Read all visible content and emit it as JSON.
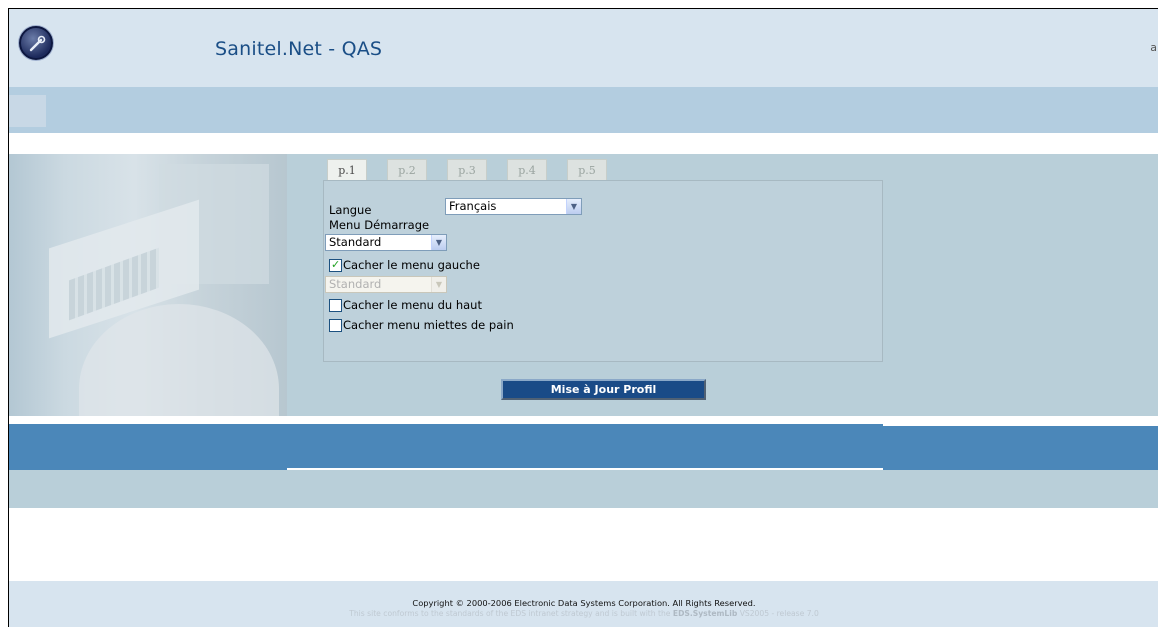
{
  "header": {
    "title": "Sanitel.Net - QAS",
    "edge_char": "a"
  },
  "tabs": [
    "p.1",
    "p.2",
    "p.3",
    "p.4",
    "p.5"
  ],
  "form": {
    "language_label": "Langue",
    "language_value": "Français",
    "start_menu_label": "Menu Démarrage",
    "start_menu_value": "Standard",
    "hide_left_menu_label": "Cacher le menu gauche",
    "hide_left_menu_checked": true,
    "left_menu_value": "Standard",
    "hide_top_menu_label": "Cacher le menu du haut",
    "hide_top_menu_checked": false,
    "hide_breadcrumb_label": "Cacher menu miettes de pain",
    "hide_breadcrumb_checked": false
  },
  "update_button": "Mise à Jour Profil",
  "footer": {
    "copyright": "Copyright © 2000-2006 Electronic Data Systems Corporation. All Rights Reserved.",
    "conform_prefix": "This site conforms to the standards of the EDS intranet strategy and is built with the",
    "conform_lib": "EDS.SystemLib",
    "conform_suffix": "VS2005 - release 7.0"
  }
}
